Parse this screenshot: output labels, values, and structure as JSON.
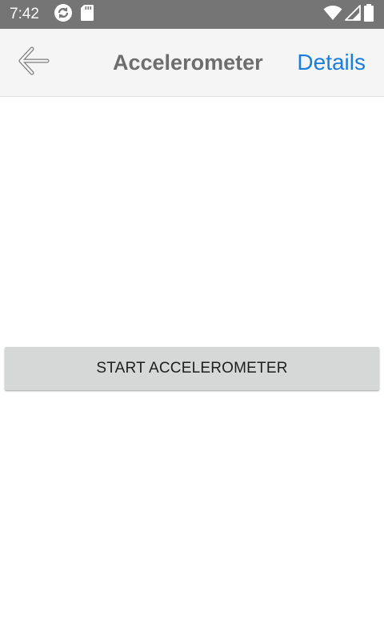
{
  "status_bar": {
    "time": "7:42",
    "left_icons": [
      "sync-icon",
      "sd-card-icon"
    ],
    "right_icons": [
      "wifi-icon",
      "cell-signal-icon",
      "battery-icon"
    ]
  },
  "nav_bar": {
    "back_icon": "back-arrow-icon",
    "title": "Accelerometer",
    "action_label": "Details"
  },
  "main": {
    "start_button_label": "START ACCELEROMETER"
  },
  "colors": {
    "status_bar_bg": "#757575",
    "nav_bar_bg": "#f5f5f5",
    "title_text": "#6d6d6d",
    "accent_link": "#1a7de0",
    "button_bg": "#d6d7d7"
  }
}
